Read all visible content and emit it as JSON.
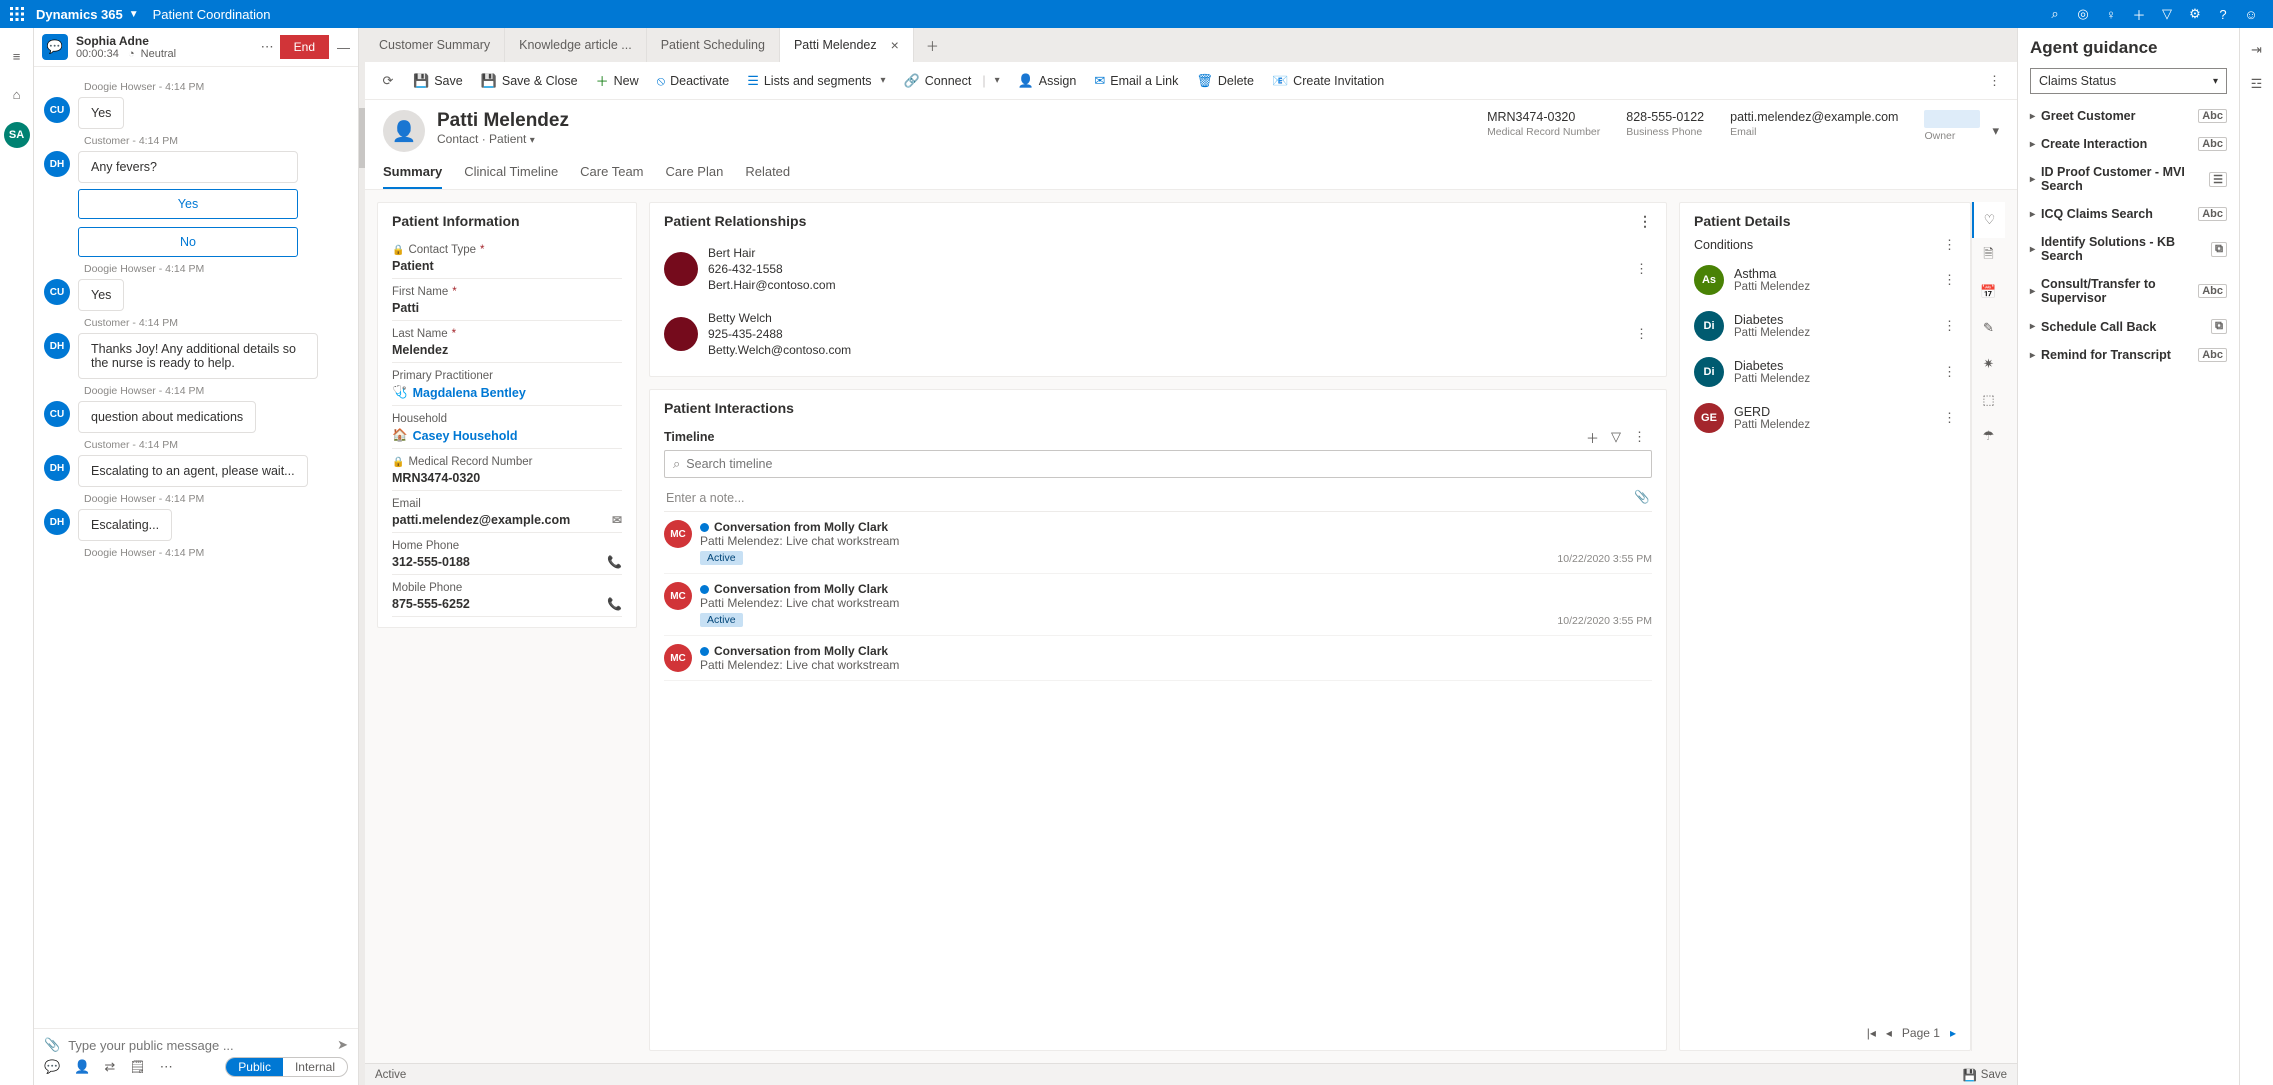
{
  "topbar": {
    "brand": "Dynamics 365",
    "module": "Patient Coordination"
  },
  "chat": {
    "name": "Sophia Adne",
    "timer": "00:00:34",
    "sentiment": "Neutral",
    "end": "End",
    "messages": [
      {
        "ts": "Doogie Howser - 4:14 PM"
      },
      {
        "av": "CU",
        "text": "Yes",
        "ts": "Customer - 4:14 PM"
      },
      {
        "av": "DH",
        "text": "Any fevers?",
        "buttons": [
          "Yes",
          "No"
        ],
        "ts": "Doogie Howser - 4:14 PM"
      },
      {
        "av": "CU",
        "text": "Yes",
        "ts": "Customer - 4:14 PM"
      },
      {
        "av": "DH",
        "text": "Thanks Joy! Any additional details so the nurse is ready to help.",
        "ts": "Doogie Howser - 4:14 PM"
      },
      {
        "av": "CU",
        "text": "question about medications",
        "ts": "Customer - 4:14 PM"
      },
      {
        "av": "DH",
        "text": "Escalating to an agent, please wait...",
        "ts": "Doogie Howser - 4:14 PM"
      },
      {
        "av": "DH",
        "text": "Escalating...",
        "ts": "Doogie Howser - 4:14 PM"
      }
    ],
    "input_placeholder": "Type your public message ...",
    "toggle": {
      "public": "Public",
      "internal": "Internal"
    }
  },
  "tabs": [
    "Customer Summary",
    "Knowledge article ...",
    "Patient Scheduling",
    "Patti Melendez"
  ],
  "cmds": {
    "save": "Save",
    "saveclose": "Save & Close",
    "new": "New",
    "deactivate": "Deactivate",
    "lists": "Lists and segments",
    "connect": "Connect",
    "assign": "Assign",
    "email": "Email a Link",
    "delete": "Delete",
    "invite": "Create Invitation"
  },
  "record": {
    "name": "Patti Melendez",
    "type": "Contact",
    "subtype": "Patient",
    "mrn": {
      "v": "MRN3474-0320",
      "l": "Medical Record Number"
    },
    "phone": {
      "v": "828-555-0122",
      "l": "Business Phone"
    },
    "email": {
      "v": "patti.melendez@example.com",
      "l": "Email"
    },
    "owner_l": "Owner"
  },
  "rtabs": [
    "Summary",
    "Clinical Timeline",
    "Care Team",
    "Care Plan",
    "Related"
  ],
  "patient_info": {
    "title": "Patient Information",
    "contact_type": {
      "l": "Contact Type",
      "v": "Patient"
    },
    "first": {
      "l": "First Name",
      "v": "Patti"
    },
    "last": {
      "l": "Last Name",
      "v": "Melendez"
    },
    "practitioner": {
      "l": "Primary Practitioner",
      "v": "Magdalena Bentley"
    },
    "household": {
      "l": "Household",
      "v": "Casey Household"
    },
    "mrn": {
      "l": "Medical Record Number",
      "v": "MRN3474-0320"
    },
    "email": {
      "l": "Email",
      "v": "patti.melendez@example.com"
    },
    "home": {
      "l": "Home Phone",
      "v": "312-555-0188"
    },
    "mobile": {
      "l": "Mobile Phone",
      "v": "875-555-6252"
    }
  },
  "relationships": {
    "title": "Patient Relationships",
    "items": [
      {
        "name": "Bert Hair",
        "phone": "626-432-1558",
        "email": "Bert.Hair@contoso.com"
      },
      {
        "name": "Betty Welch",
        "phone": "925-435-2488",
        "email": "Betty.Welch@contoso.com"
      }
    ]
  },
  "interactions": {
    "title": "Patient Interactions",
    "timeline_label": "Timeline",
    "search_placeholder": "Search timeline",
    "note_placeholder": "Enter a note...",
    "items": [
      {
        "av": "MC",
        "title": "Conversation from Molly Clark",
        "sub": "Patti Melendez: Live chat workstream",
        "badge": "Active",
        "dt": "10/22/2020 3:55 PM"
      },
      {
        "av": "MC",
        "title": "Conversation from Molly Clark",
        "sub": "Patti Melendez: Live chat workstream",
        "badge": "Active",
        "dt": "10/22/2020 3:55 PM"
      },
      {
        "av": "MC",
        "title": "Conversation from Molly Clark",
        "sub": "Patti Melendez: Live chat workstream"
      }
    ]
  },
  "details": {
    "title": "Patient Details",
    "section": "Conditions",
    "items": [
      {
        "code": "As",
        "color": "#498205",
        "name": "Asthma",
        "patient": "Patti Melendez"
      },
      {
        "code": "Di",
        "color": "#005b70",
        "name": "Diabetes",
        "patient": "Patti Melendez"
      },
      {
        "code": "Di",
        "color": "#005b70",
        "name": "Diabetes",
        "patient": "Patti Melendez"
      },
      {
        "code": "GE",
        "color": "#a4262c",
        "name": "GERD",
        "patient": "Patti Melendez"
      }
    ],
    "page": "Page 1"
  },
  "guide": {
    "title": "Agent guidance",
    "select": "Claims Status",
    "items": [
      {
        "t": "Greet Customer",
        "i": "Abc"
      },
      {
        "t": "Create Interaction",
        "i": "Abc"
      },
      {
        "t": "ID Proof Customer - MVI Search",
        "i": "☰"
      },
      {
        "t": "ICQ Claims Search",
        "i": "Abc"
      },
      {
        "t": "Identify Solutions - KB Search",
        "i": "⧉"
      },
      {
        "t": "Consult/Transfer to Supervisor",
        "i": "Abc"
      },
      {
        "t": "Schedule Call Back",
        "i": "⧉"
      },
      {
        "t": "Remind for Transcript",
        "i": "Abc"
      }
    ]
  },
  "status": {
    "left": "Active",
    "save": "Save"
  }
}
